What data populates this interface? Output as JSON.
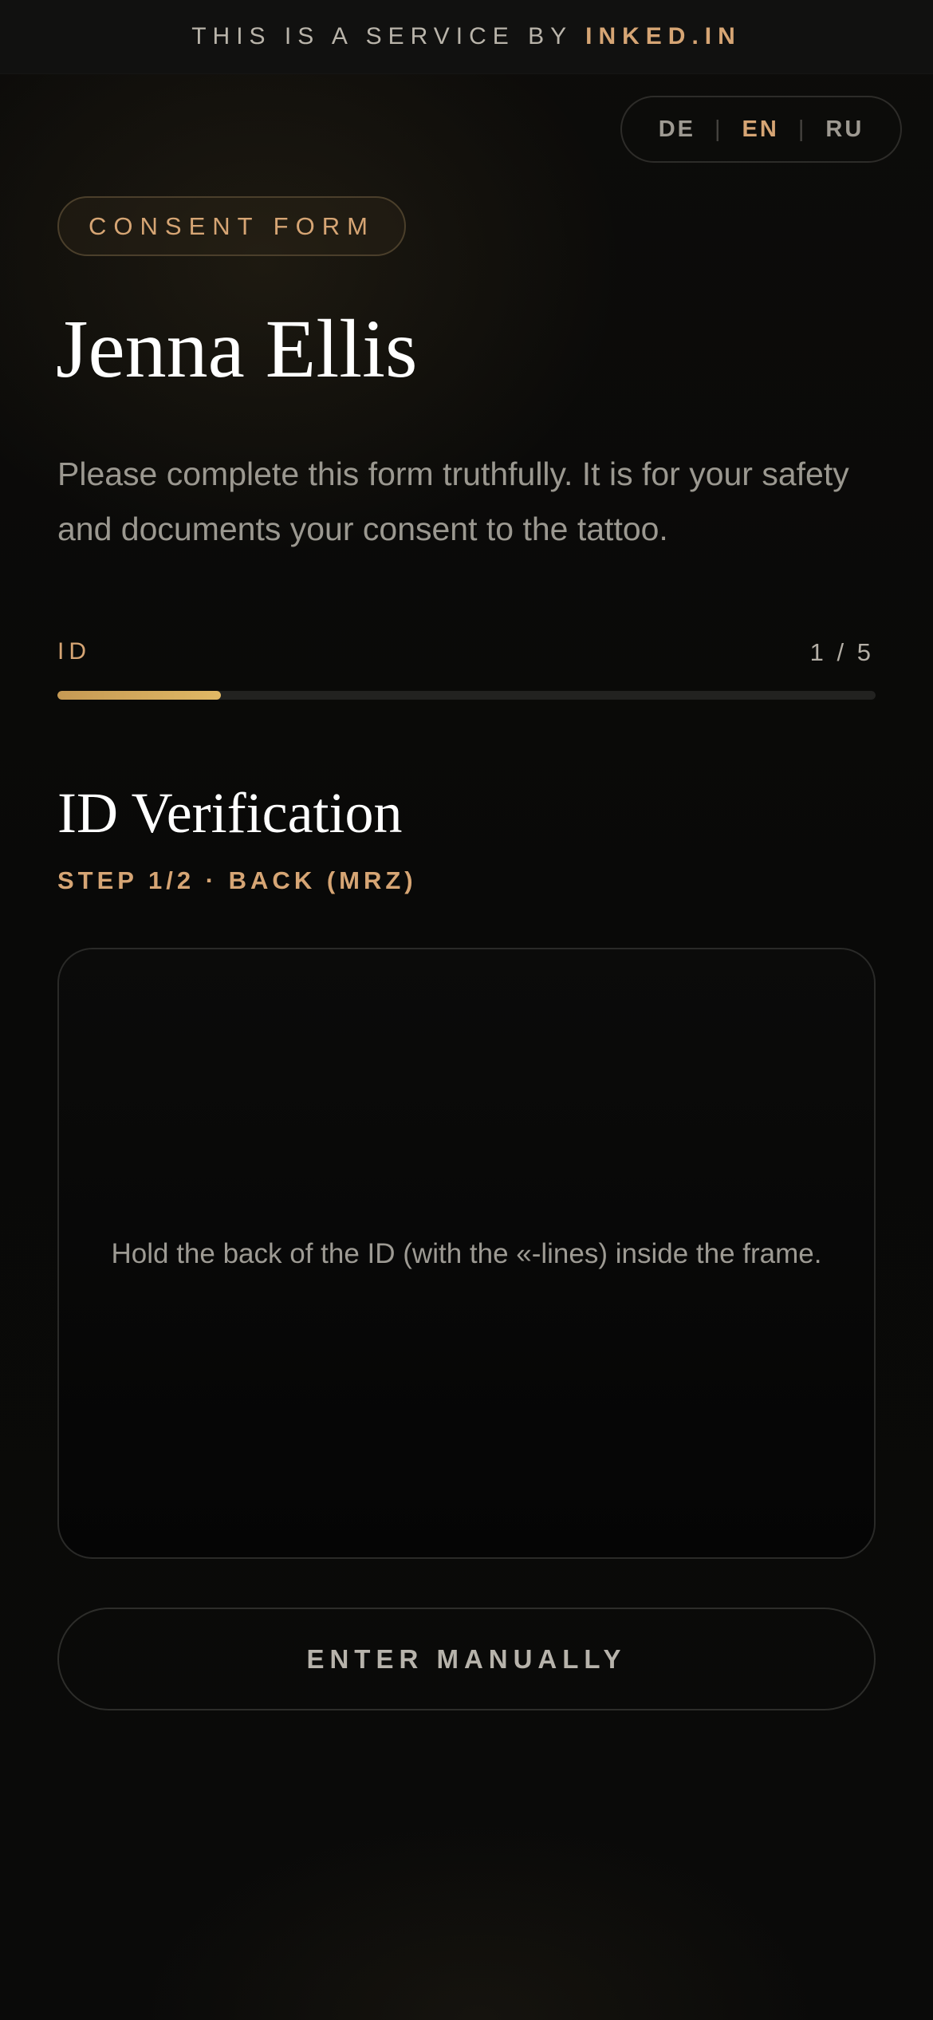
{
  "topbar": {
    "prefix": "THIS IS A SERVICE BY",
    "brand": "INKED.IN"
  },
  "language_switch": {
    "options": [
      "DE",
      "EN",
      "RU"
    ],
    "separator": "|",
    "active": "EN"
  },
  "header": {
    "badge": "CONSENT FORM",
    "client_name": "Jenna Ellis",
    "intro": "Please complete this form truthfully. It is for your safety and documents your consent to the tattoo."
  },
  "progress": {
    "label": "ID",
    "counter": "1 / 5",
    "fraction": 0.2
  },
  "section": {
    "title": "ID Verification",
    "step": "STEP 1/2 · BACK (MRZ)"
  },
  "scanner": {
    "hint": "Hold the back of the ID (with the «-lines) inside the frame."
  },
  "actions": {
    "manual_label": "ENTER MANUALLY"
  },
  "colors": {
    "accent": "#d6a574",
    "progress_fill": "#d4aa5c",
    "background": "#0b0b0a"
  }
}
